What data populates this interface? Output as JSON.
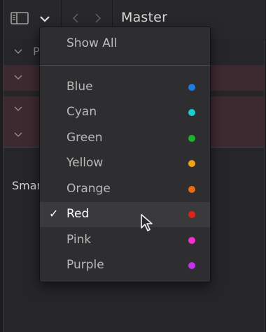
{
  "toolbar": {
    "title": "Master",
    "sidebar_icon": "sidebar-toggle-icon",
    "dropdown_icon": "chevron-down-icon",
    "back_icon": "chevron-left-icon",
    "forward_icon": "chevron-right-icon"
  },
  "tree": {
    "header_initial": "P",
    "smart_label": "Smar"
  },
  "menu": {
    "show_all": "Show All",
    "items": [
      {
        "label": "Blue",
        "color": "#1f7ae0",
        "checked": false
      },
      {
        "label": "Cyan",
        "color": "#19cdd6",
        "checked": false
      },
      {
        "label": "Green",
        "color": "#1bb32a",
        "checked": false
      },
      {
        "label": "Yellow",
        "color": "#f0a21a",
        "checked": false
      },
      {
        "label": "Orange",
        "color": "#ee6a12",
        "checked": false
      },
      {
        "label": "Red",
        "color": "#e0231a",
        "checked": true
      },
      {
        "label": "Pink",
        "color": "#f22fd0",
        "checked": false
      },
      {
        "label": "Purple",
        "color": "#c530f0",
        "checked": false
      }
    ],
    "check_mark": "✓"
  },
  "colors": {
    "background": "#262629",
    "menu_background": "#2e2e31",
    "red_rows": "#3d2a30"
  }
}
